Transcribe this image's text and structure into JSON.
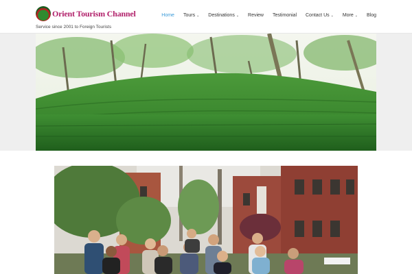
{
  "brand": {
    "name": "Orient Tourism Channel",
    "tagline": "Service since 2001 to Foreign Tourists"
  },
  "nav": [
    {
      "label": "Home",
      "active": true,
      "dropdown": false
    },
    {
      "label": "Tours",
      "active": false,
      "dropdown": true
    },
    {
      "label": "Destinations",
      "active": false,
      "dropdown": true
    },
    {
      "label": "Review",
      "active": false,
      "dropdown": false
    },
    {
      "label": "Testimonial",
      "active": false,
      "dropdown": false
    },
    {
      "label": "Contact Us",
      "active": false,
      "dropdown": true
    },
    {
      "label": "More",
      "active": false,
      "dropdown": true
    },
    {
      "label": "Blog",
      "active": false,
      "dropdown": false
    }
  ],
  "colors": {
    "accent": "#3a9ad9",
    "brand": "#b1206a"
  },
  "images": {
    "hero": "tea-garden-hills",
    "group": "tourist-group-red-brick-building"
  }
}
